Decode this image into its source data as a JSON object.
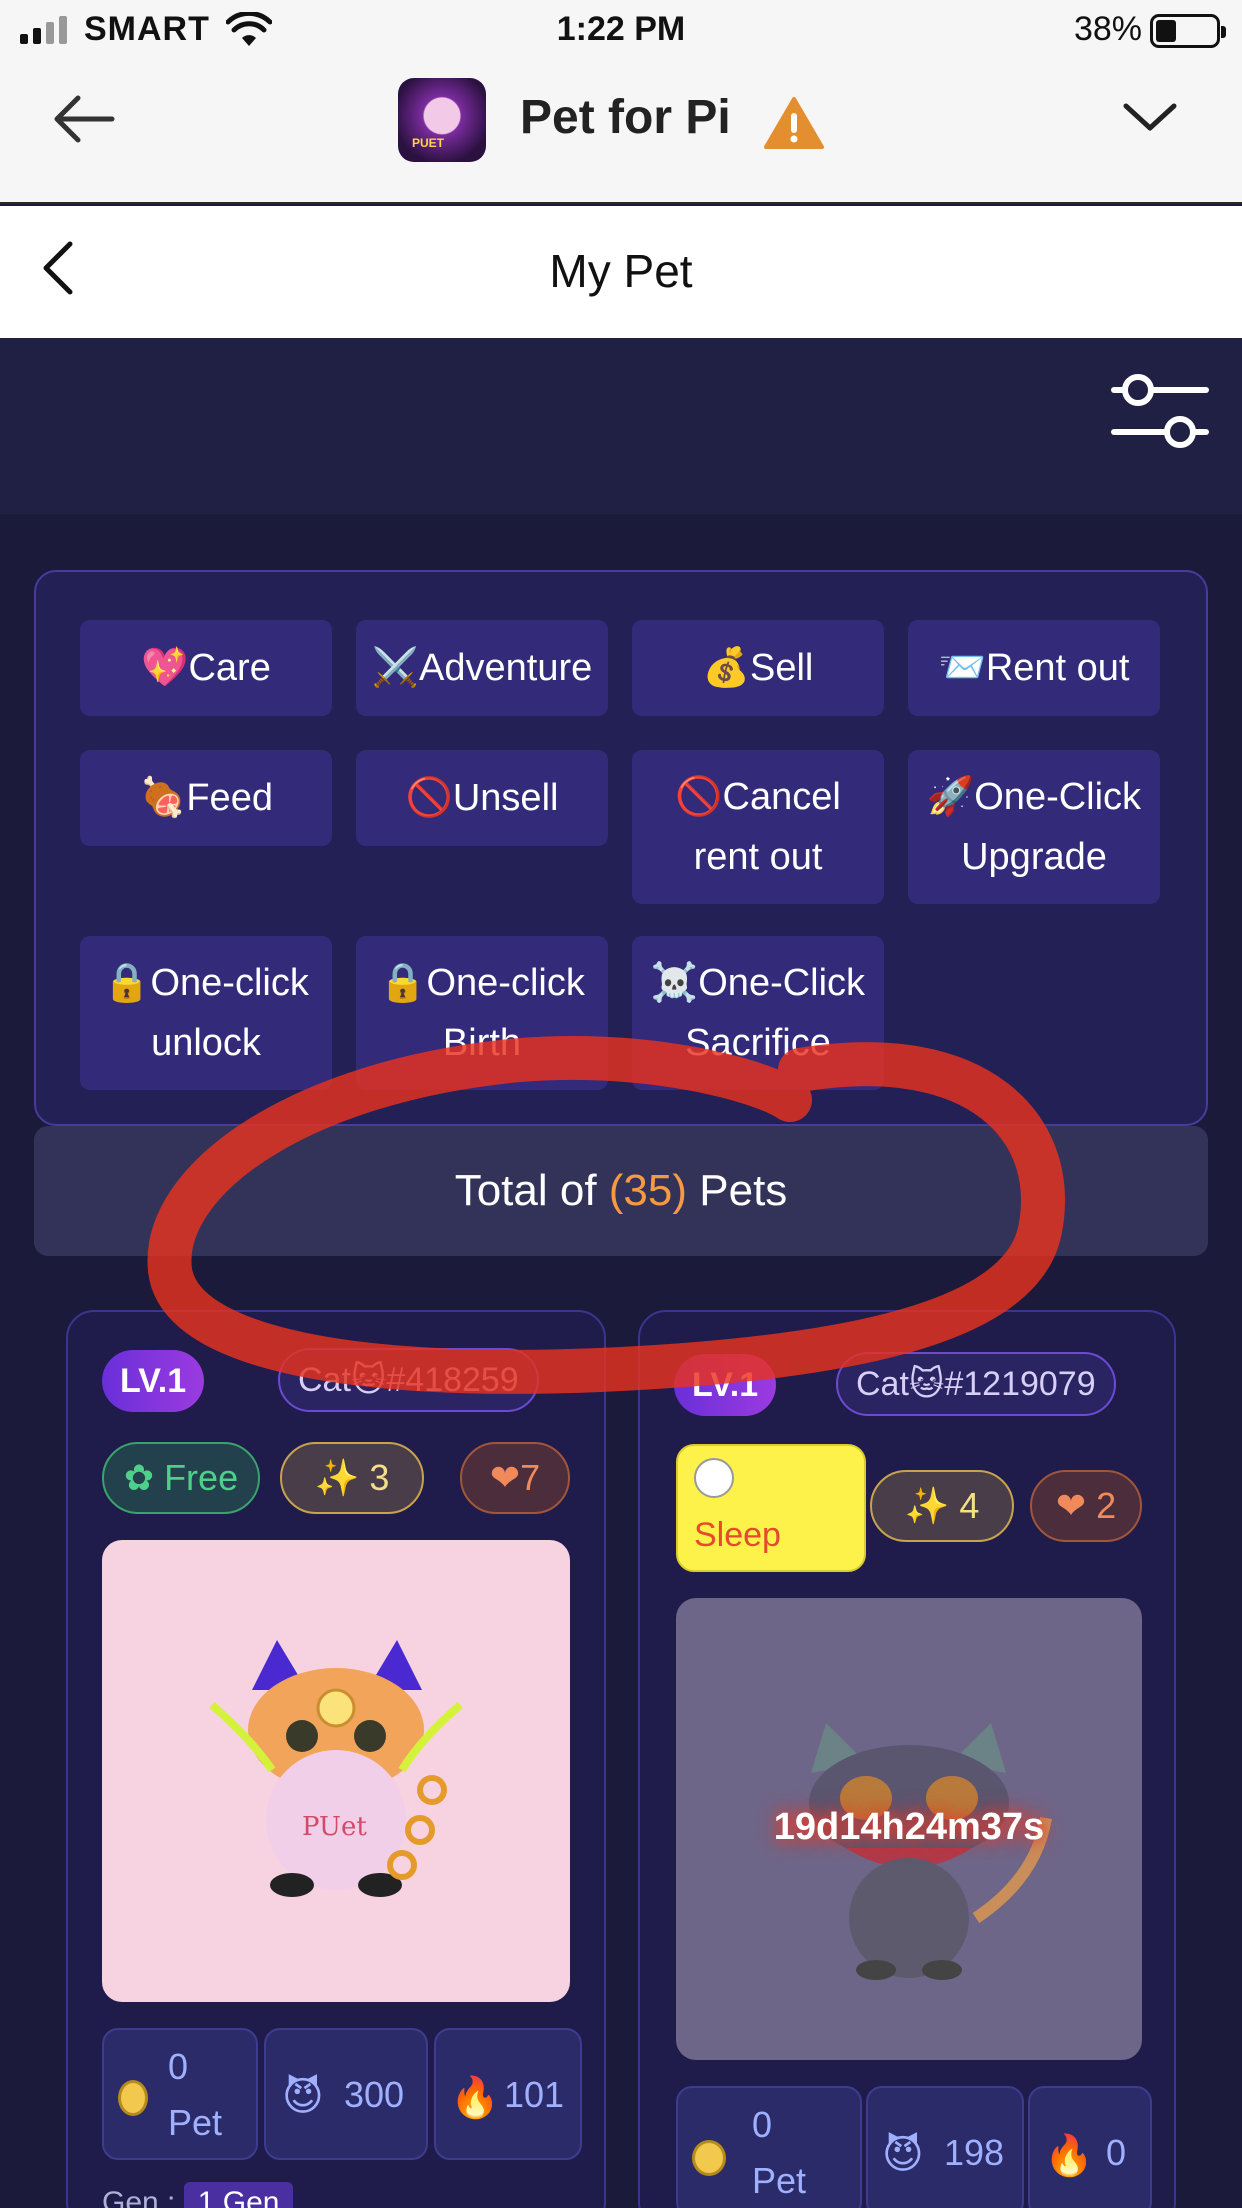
{
  "status_bar": {
    "carrier": "SMART",
    "time": "1:22 PM",
    "battery": "38%"
  },
  "browser": {
    "app_title": "Pet for Pi"
  },
  "page": {
    "title": "My Pet"
  },
  "actions": [
    {
      "icon": "💖",
      "label": "Care"
    },
    {
      "icon": "⚔️",
      "label": "Adventure"
    },
    {
      "icon": "💰",
      "label": "Sell"
    },
    {
      "icon": "📨",
      "label": "Rent out"
    },
    {
      "icon": "🍖",
      "label": "Feed"
    },
    {
      "icon": "🚫",
      "label": "Unsell"
    },
    {
      "icon": "🚫",
      "label": "Cancel rent out"
    },
    {
      "icon": "🚀",
      "label": "One-Click Upgrade"
    },
    {
      "icon": "🔒",
      "label": "One-click unlock"
    },
    {
      "icon": "🔒",
      "label": "One-click Birth"
    },
    {
      "icon": "☠️",
      "label": "One-Click Sacrifice"
    }
  ],
  "total": {
    "prefix": "Total of ",
    "count": "(35)",
    "suffix": " Pets"
  },
  "pets": [
    {
      "level": "LV.1",
      "id": "Cat🐱#418259",
      "status": "Free",
      "stars": "3",
      "hearts": "7",
      "stats": {
        "pet": "0",
        "pet_label": "Pet",
        "power": "300",
        "fire": "101"
      },
      "gen_label": "Gen :",
      "gen": "1 Gen",
      "pet_text": "PUet"
    },
    {
      "level": "LV.1",
      "id": "Cat🐱#1219079",
      "status": "Sleep",
      "stars": "4",
      "hearts": "2",
      "timer": "19d14h24m37s",
      "stats": {
        "pet": "0",
        "pet_label": "Pet",
        "power": "198",
        "fire": "0"
      }
    }
  ],
  "colors": {
    "accent": "#f39a43",
    "panel": "#232056",
    "button": "#332a7a",
    "annotation": "#e8321f"
  }
}
